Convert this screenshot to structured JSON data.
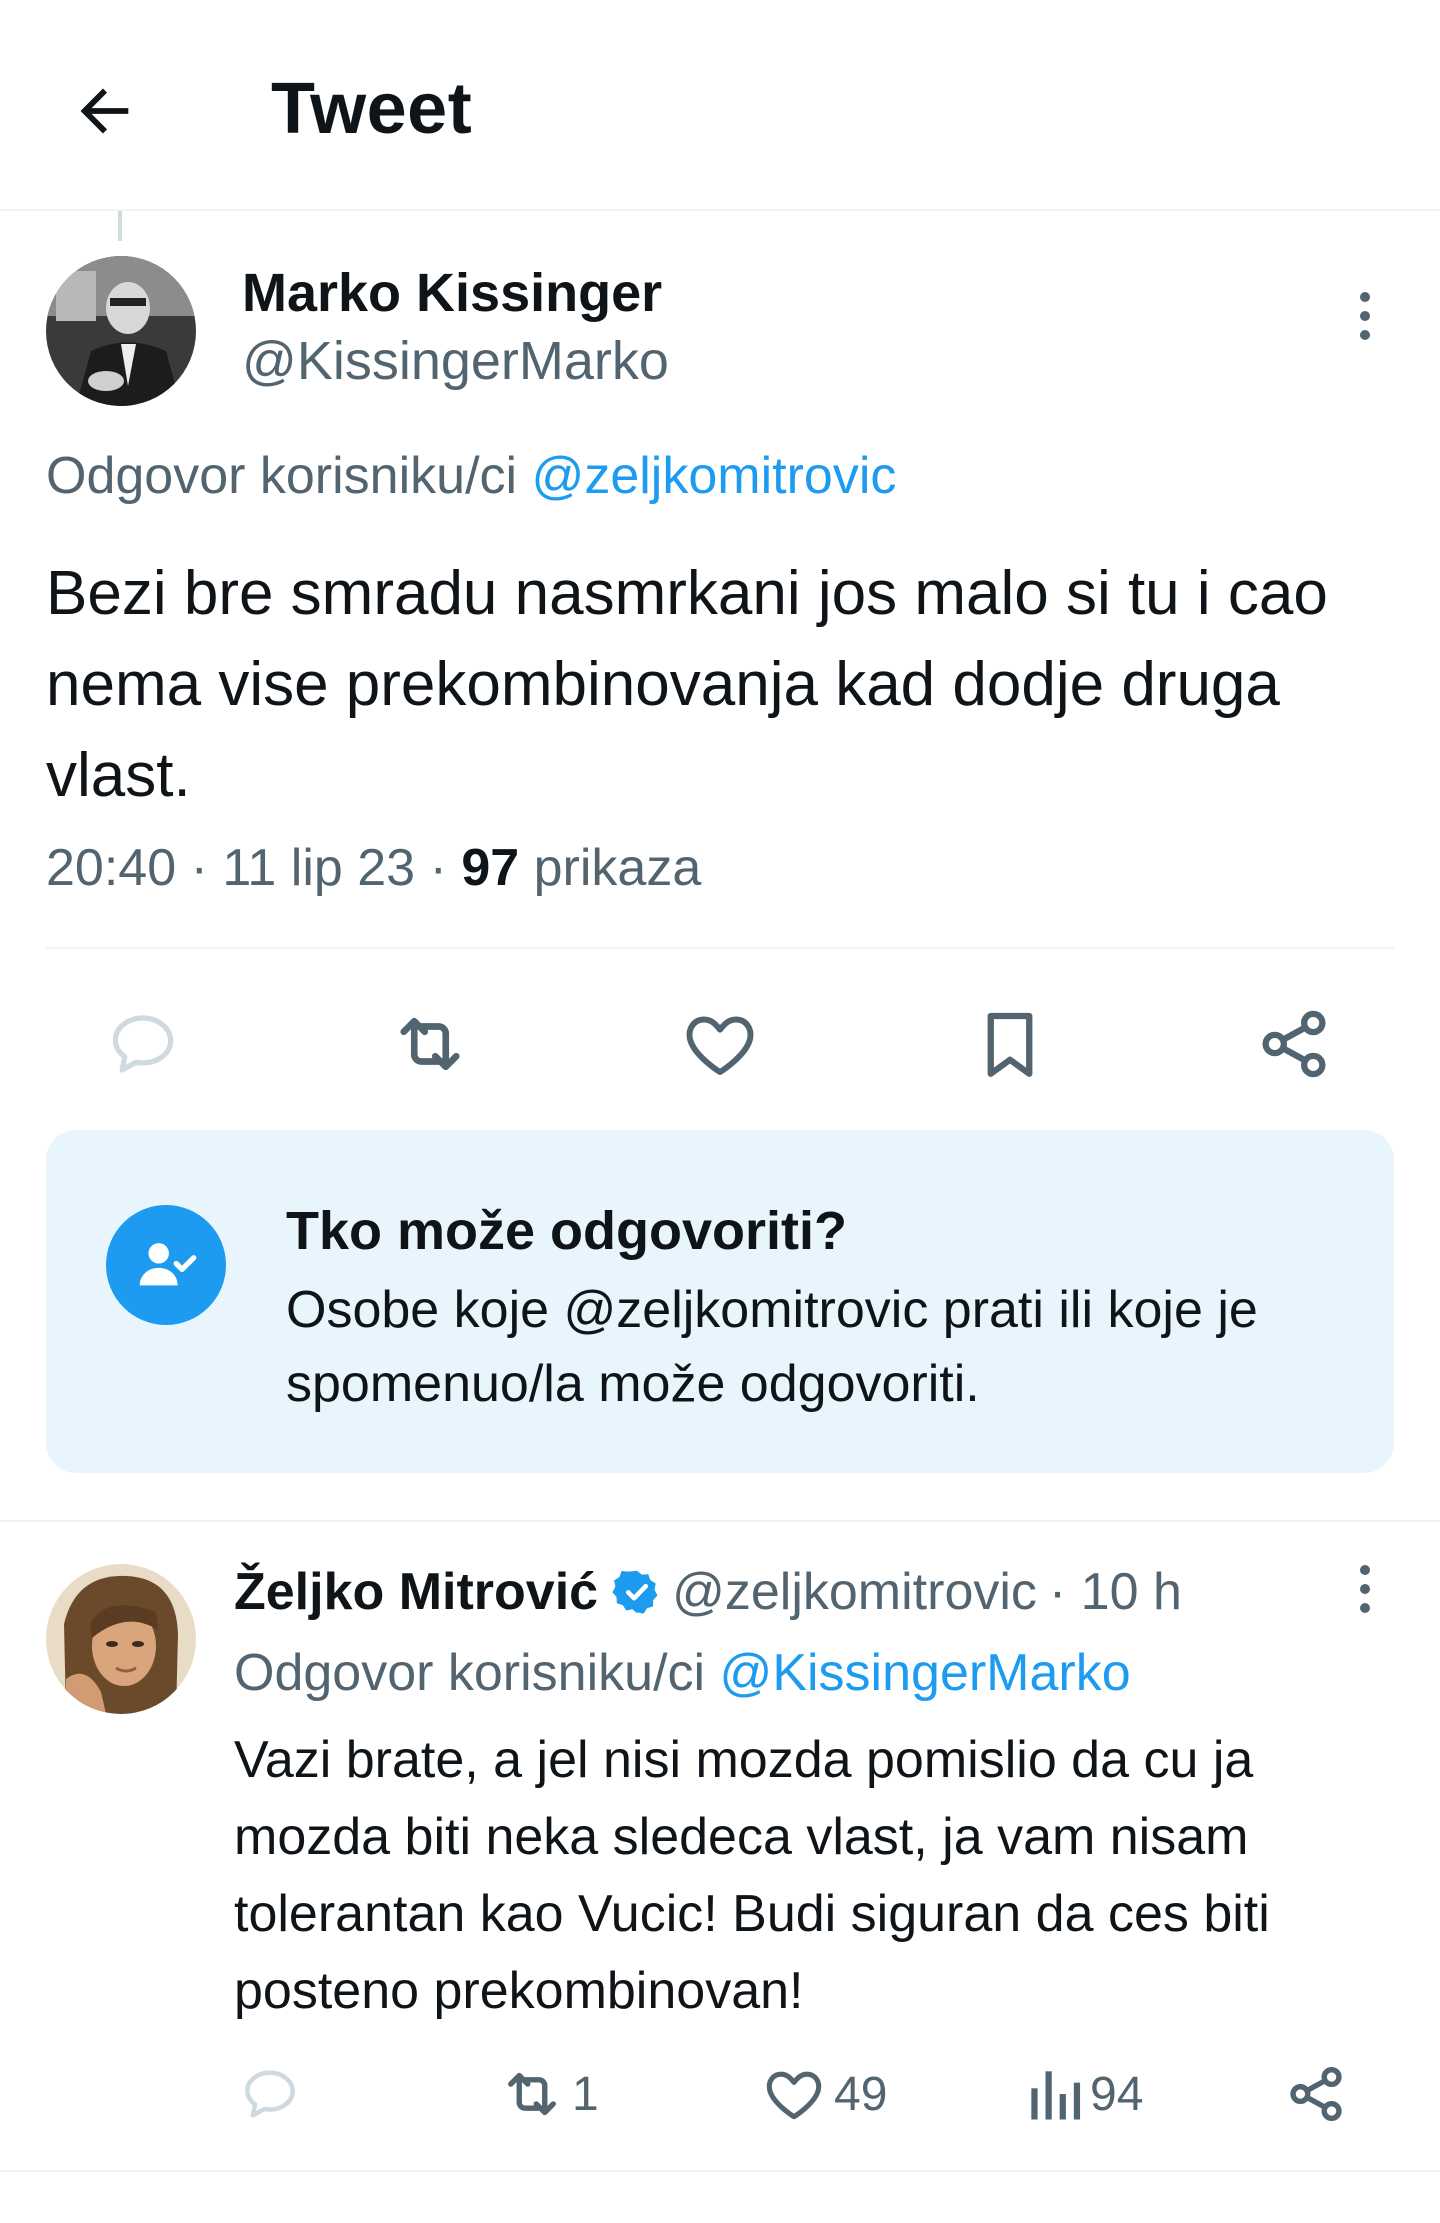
{
  "header": {
    "title": "Tweet",
    "back_icon": "arrow-left-icon"
  },
  "main_tweet": {
    "author_name": "Marko Kissinger",
    "author_handle": "@KissingerMarko",
    "reply_prefix": "Odgovor korisniku/ci",
    "reply_handle": "@zeljkomitrovic",
    "text": "Bezi bre smradu nasmrkani jos malo si tu i cao nema vise prekombinovanja kad dodje druga vlast.",
    "time": "20:40",
    "date": "11 lip 23",
    "views_count": "97",
    "views_label": "prikaza",
    "actions": [
      "reply-icon",
      "retweet-icon",
      "like-icon",
      "bookmark-icon",
      "share-icon"
    ]
  },
  "who_can_reply": {
    "title": "Tko može odgovoriti?",
    "body": "Osobe koje @zeljkomitrovic prati ili koje je spomenuo/la može odgovoriti."
  },
  "reply_tweet": {
    "author_name": "Željko Mitrović",
    "author_handle": "@zeljkomitrovic",
    "time_ago": "· 10 h",
    "reply_prefix": "Odgovor korisniku/ci",
    "reply_handle": "@KissingerMarko",
    "text": "Vazi brate, a jel nisi mozda pomislio da cu ja mozda biti neka sledeca vlast, ja vam nisam tolerantan kao Vucic! Budi siguran da ces biti posteno prekombinovan!",
    "retweets": "1",
    "likes": "49",
    "views": "94"
  },
  "colors": {
    "accent": "#1d9bf0",
    "muted": "#536471",
    "text": "#0f1419",
    "card_bg": "#e8f5fd"
  }
}
